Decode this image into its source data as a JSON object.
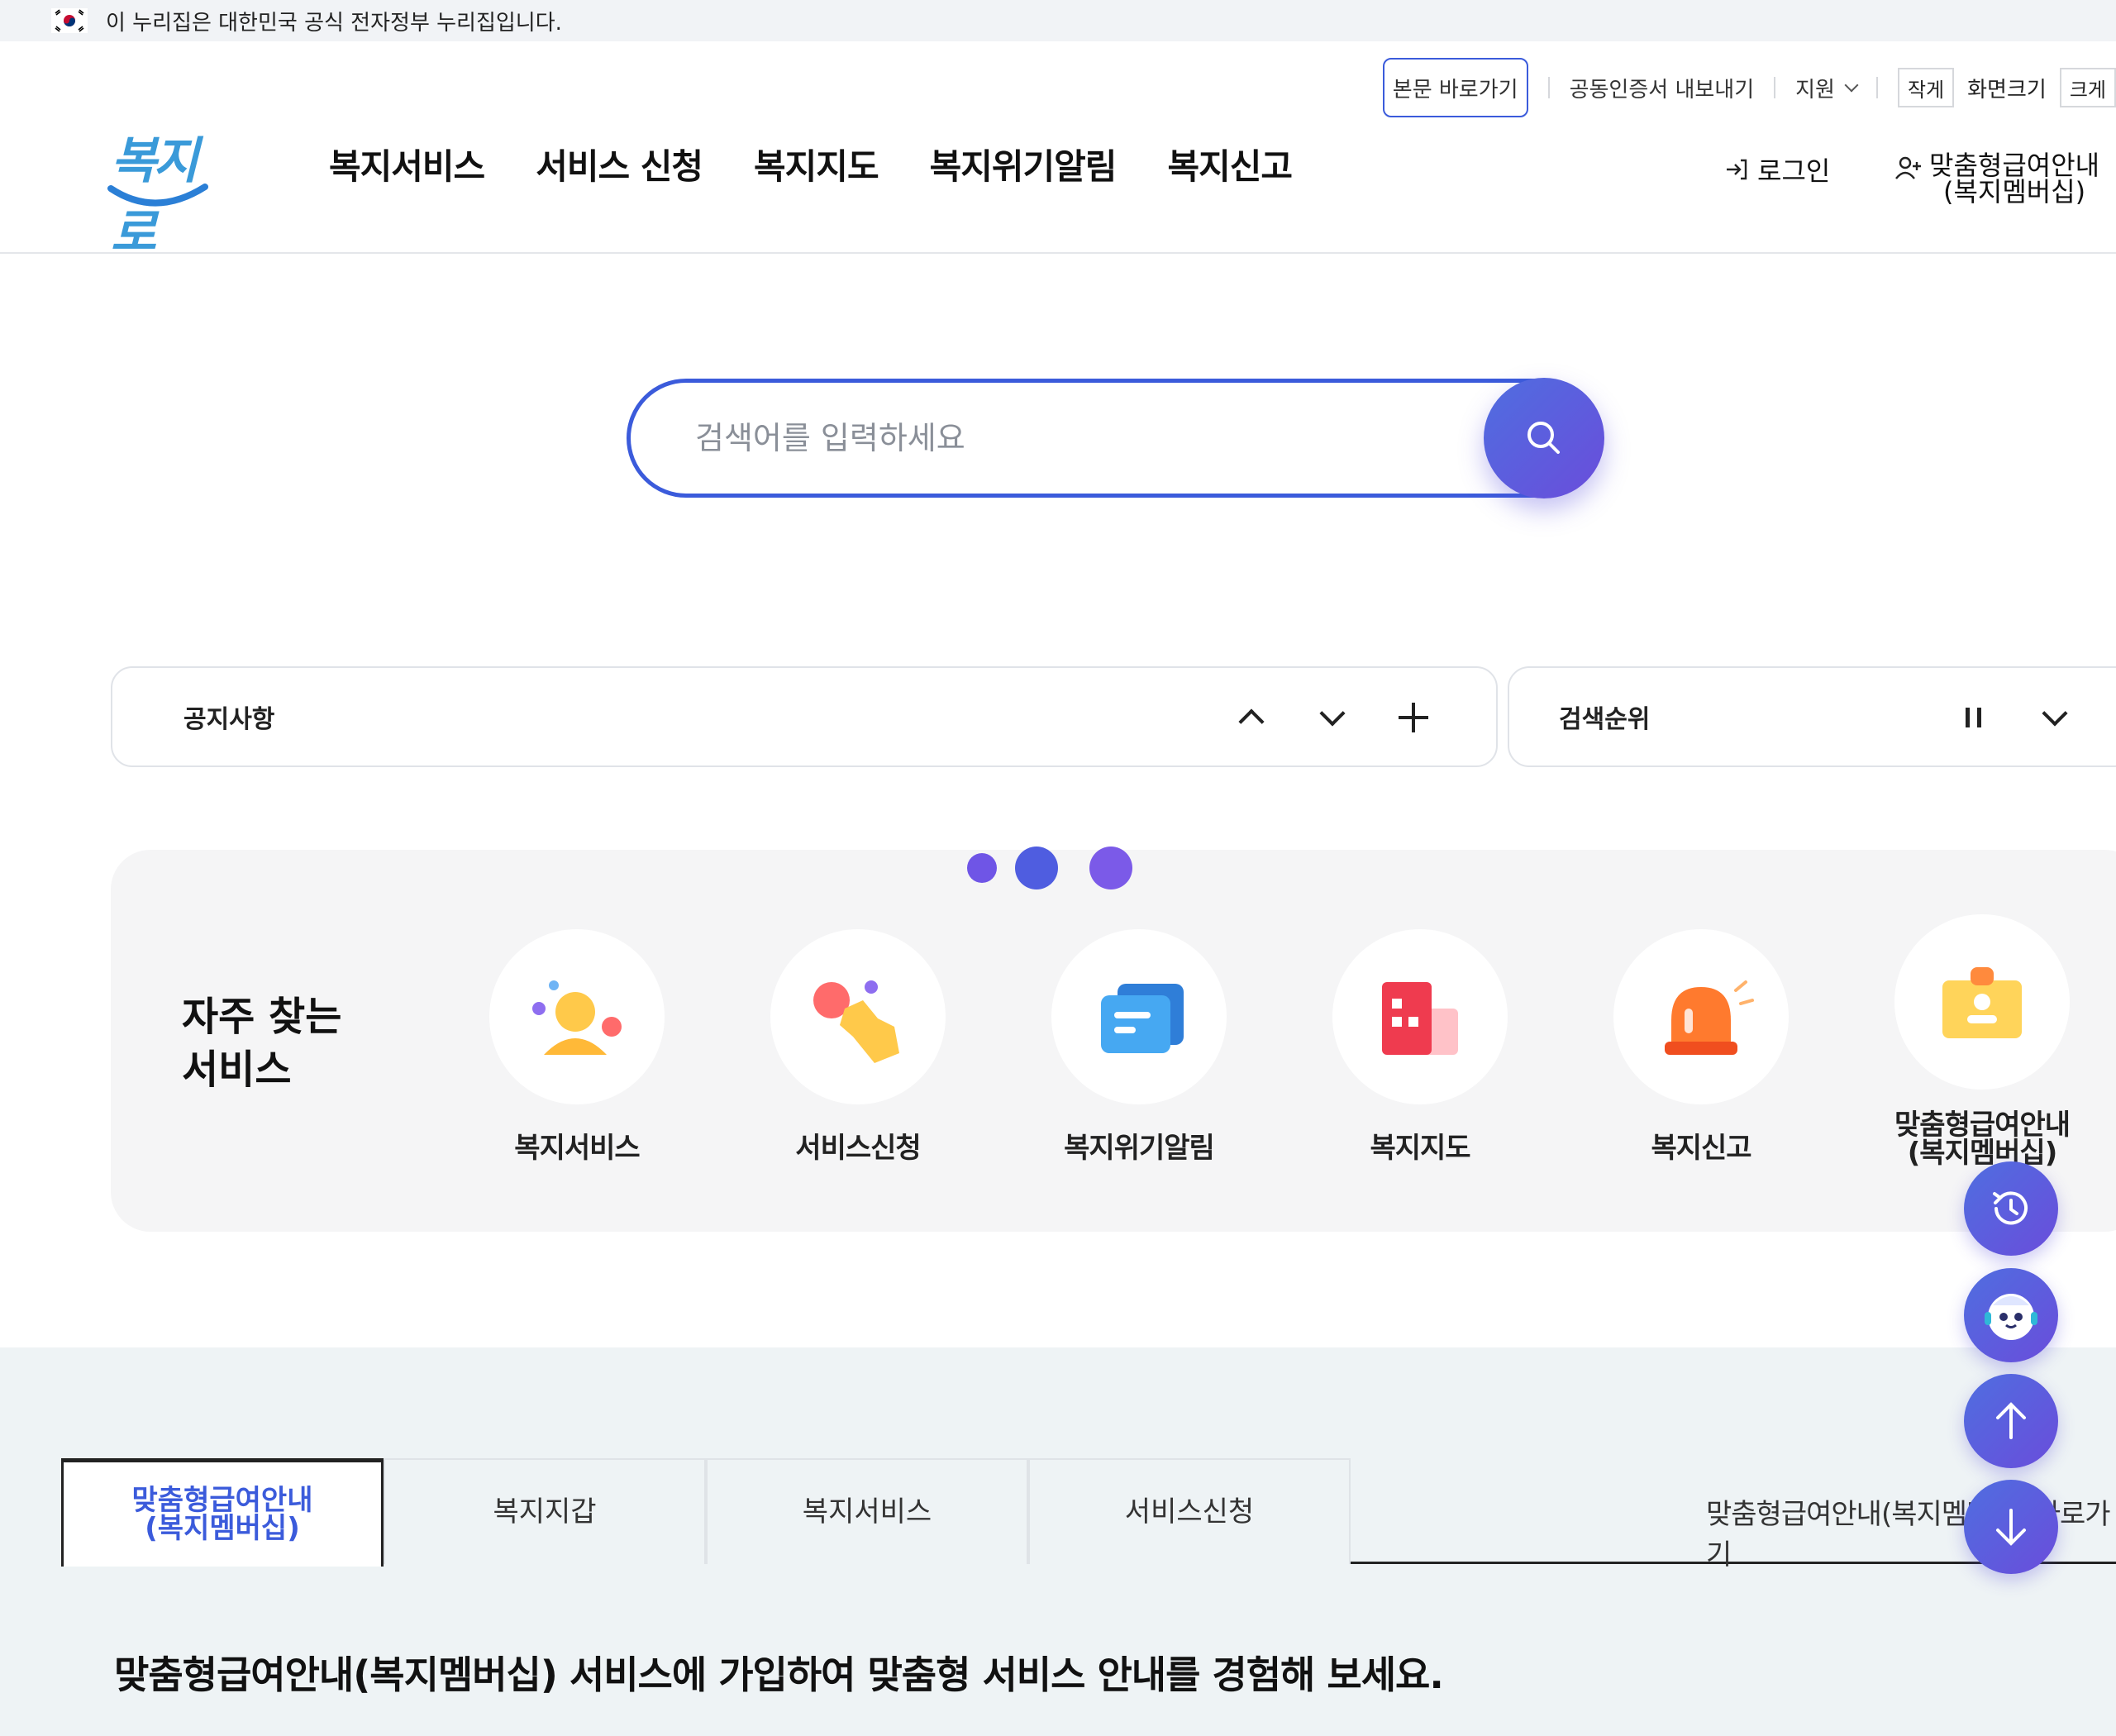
{
  "gov_banner": {
    "text": "이 누리집은 대한민국 공식 전자정부 누리집입니다."
  },
  "util": {
    "skip": "본문 바로가기",
    "cert": "공동인증서 내보내기",
    "support": "지원",
    "smaller": "작게",
    "screen_size": "화면크기",
    "larger": "크게"
  },
  "logo": {
    "text": "복지로"
  },
  "gnb": [
    "복지서비스",
    "서비스 신청",
    "복지지도",
    "복지위기알림",
    "복지신고"
  ],
  "auth": {
    "login": "로그인",
    "member_line1": "맞춤형급여안내",
    "member_line2": "(복지멤버십)"
  },
  "search": {
    "placeholder": "검색어를 입력하세요"
  },
  "notice": {
    "title": "공지사항"
  },
  "ranking": {
    "title": "검색순위"
  },
  "freq": {
    "title_line1": "자주 찾는",
    "title_line2": "서비스",
    "items": [
      {
        "label": "복지서비스",
        "icon": "person-icon"
      },
      {
        "label": "서비스신청",
        "icon": "hand-pointer-icon"
      },
      {
        "label": "복지위기알림",
        "icon": "message-card-icon"
      },
      {
        "label": "복지지도",
        "icon": "building-icon"
      },
      {
        "label": "복지신고",
        "icon": "siren-icon"
      },
      {
        "label_line1": "맞춤형급여안내",
        "label_line2": "(복지멤버십)",
        "icon": "id-card-icon"
      }
    ]
  },
  "tabs": [
    {
      "line1": "맞춤형급여안내",
      "line2": "(복지멤버십)",
      "active": true
    },
    {
      "label": "복지지갑"
    },
    {
      "label": "복지서비스"
    },
    {
      "label": "서비스신청"
    }
  ],
  "tab_right": "맞춤형급여안내(복지멤버십) 바로가기",
  "bottom_text": "맞춤형급여안내(복지멤버십) 서비스에 가입하여 맞춤형 서비스 안내를 경험해 보세요.",
  "colors": {
    "primary": "#3b5bdb",
    "accent_purple": "#6a4ddb",
    "panel_bg": "#f5f5f6"
  }
}
